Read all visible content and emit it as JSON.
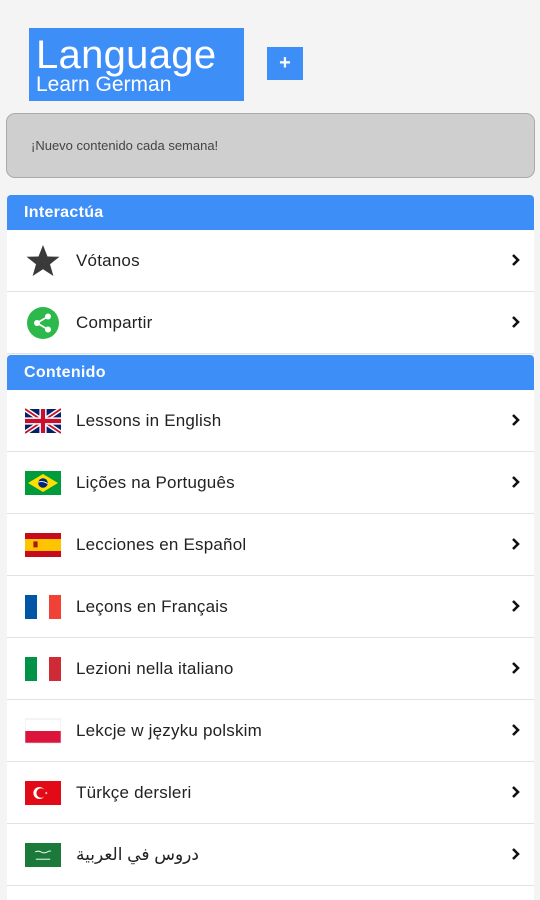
{
  "app": {
    "title": "Language",
    "subtitle": "Learn German",
    "add_button": "+"
  },
  "banner": {
    "text": "¡Nuevo contenido cada semana!"
  },
  "interact": {
    "heading": "Interactúa",
    "items": [
      {
        "label": "Vótanos",
        "icon": "star-icon"
      },
      {
        "label": "Compartir",
        "icon": "share-icon"
      }
    ]
  },
  "content": {
    "heading": "Contenido",
    "items": [
      {
        "label": "Lessons in English",
        "icon": "uk-flag-icon"
      },
      {
        "label": "Lições na Português",
        "icon": "brazil-flag-icon"
      },
      {
        "label": "Lecciones en Español",
        "icon": "spain-flag-icon"
      },
      {
        "label": "Leçons en Français",
        "icon": "france-flag-icon"
      },
      {
        "label": "Lezioni nella italiano",
        "icon": "italy-flag-icon"
      },
      {
        "label": "Lekcje w języku polskim",
        "icon": "poland-flag-icon"
      },
      {
        "label": "Türkçe dersleri",
        "icon": "turkey-flag-icon"
      },
      {
        "label": "دروس في العربية",
        "icon": "saudi-flag-icon"
      }
    ]
  },
  "colors": {
    "accent": "#3e8ef7",
    "share_green": "#2db84b",
    "banner_bg": "#cfcfcf"
  }
}
